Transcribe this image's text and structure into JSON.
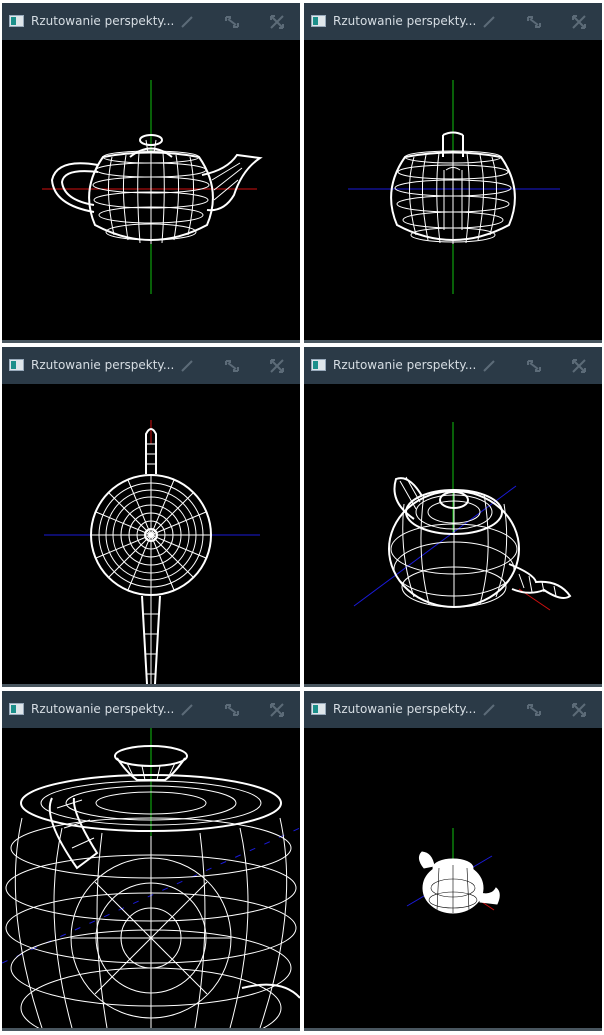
{
  "windows": [
    {
      "id": "front-view",
      "title": "Rzutowanie perspekty..."
    },
    {
      "id": "side-view",
      "title": "Rzutowanie perspekty..."
    },
    {
      "id": "top-view",
      "title": "Rzutowanie perspekty..."
    },
    {
      "id": "iso-view",
      "title": "Rzutowanie perspekty..."
    },
    {
      "id": "closeup-view",
      "title": "Rzutowanie perspekty..."
    },
    {
      "id": "far-view",
      "title": "Rzutowanie perspekty..."
    }
  ],
  "colors": {
    "titlebar": "#2b3a47",
    "canvas": "#000000",
    "wire": "#ffffff",
    "axis_x": "#d01010",
    "axis_y": "#10c010",
    "axis_z": "#1a1ad8"
  },
  "icons": [
    "app-window-icon",
    "minimize-icon",
    "maximize-icon",
    "close-icon"
  ]
}
